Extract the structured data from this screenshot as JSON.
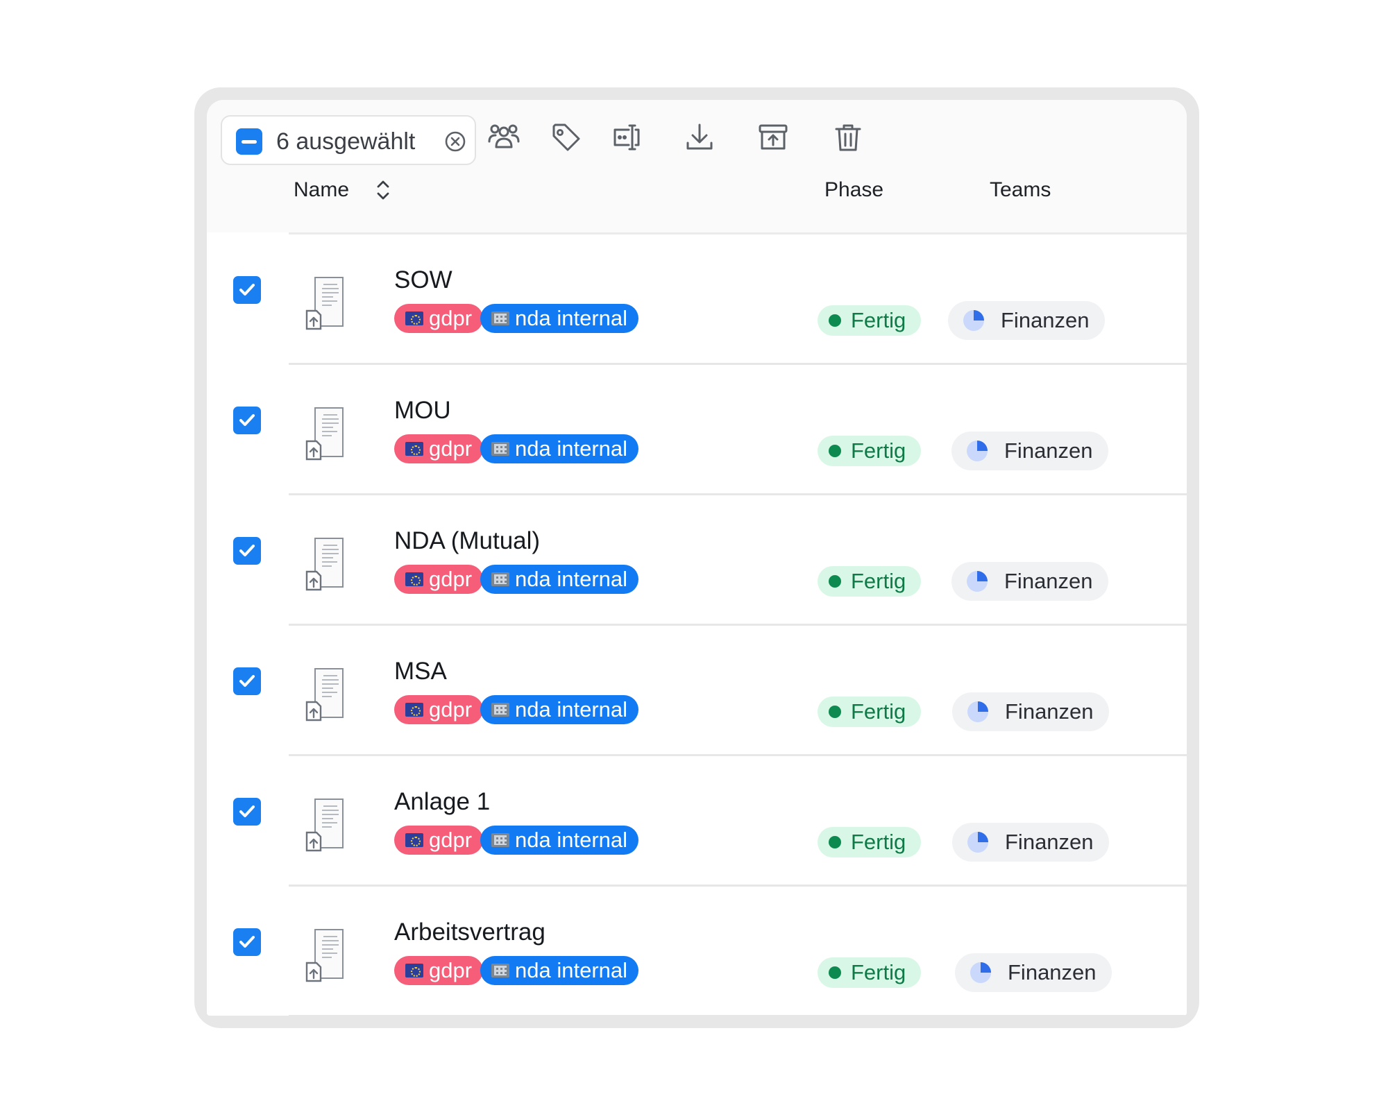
{
  "selection": {
    "count_label": "6 ausgewählt"
  },
  "toolbar": {
    "icons": [
      "teams-icon",
      "tag-icon",
      "rename-icon",
      "download-icon",
      "archive-icon",
      "trash-icon"
    ]
  },
  "columns": {
    "name": "Name",
    "phase": "Phase",
    "teams": "Teams"
  },
  "colors": {
    "accent": "#1a7ff0",
    "tag_red": "#f55d79",
    "tag_blue": "#127af3",
    "phase_bg": "#d9f7e7",
    "phase_text": "#0f7a47"
  },
  "rows": [
    {
      "name": "SOW",
      "tags": [
        "gdpr",
        "nda internal"
      ],
      "phase": "Fertig",
      "team": "Finanzen"
    },
    {
      "name": "MOU",
      "tags": [
        "gdpr",
        "nda internal"
      ],
      "phase": "Fertig",
      "team": "Finanzen"
    },
    {
      "name": "NDA (Mutual)",
      "tags": [
        "gdpr",
        "nda internal"
      ],
      "phase": "Fertig",
      "team": "Finanzen"
    },
    {
      "name": "MSA",
      "tags": [
        "gdpr",
        "nda internal"
      ],
      "phase": "Fertig",
      "team": "Finanzen"
    },
    {
      "name": "Anlage 1",
      "tags": [
        "gdpr",
        "nda internal"
      ],
      "phase": "Fertig",
      "team": "Finanzen"
    },
    {
      "name": "Arbeitsvertrag",
      "tags": [
        "gdpr",
        "nda internal"
      ],
      "phase": "Fertig",
      "team": "Finanzen"
    }
  ]
}
